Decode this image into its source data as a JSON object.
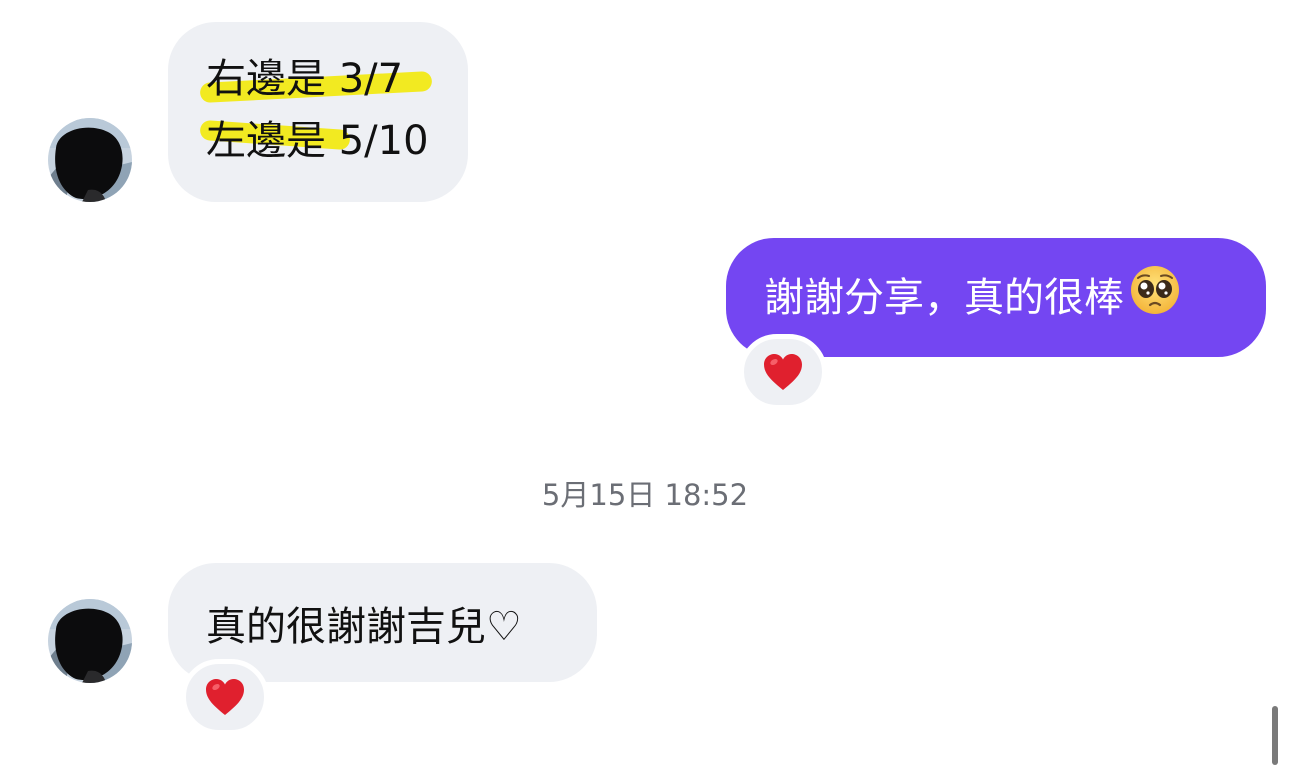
{
  "messages": [
    {
      "direction": "incoming",
      "lines": [
        "右邊是 3/7",
        "左邊是 5/10"
      ],
      "highlight_color": "#f2ea21",
      "bubble_color": "#eef0f4"
    },
    {
      "direction": "outgoing",
      "text": "謝謝分享，真的很棒",
      "emoji": "pleading-face-emoji",
      "bubble_color": "#7446f2",
      "reaction": "red-heart-emoji"
    },
    {
      "direction": "incoming",
      "text": "真的很謝謝吉兒♡",
      "bubble_color": "#eef0f4",
      "reaction": "red-heart-emoji"
    }
  ],
  "timestamp": "5月15日 18:52",
  "colors": {
    "accent": "#7446f2",
    "incoming_bubble": "#eef0f4",
    "timestamp_text": "#6b6e75",
    "heart": "#e0202e"
  }
}
